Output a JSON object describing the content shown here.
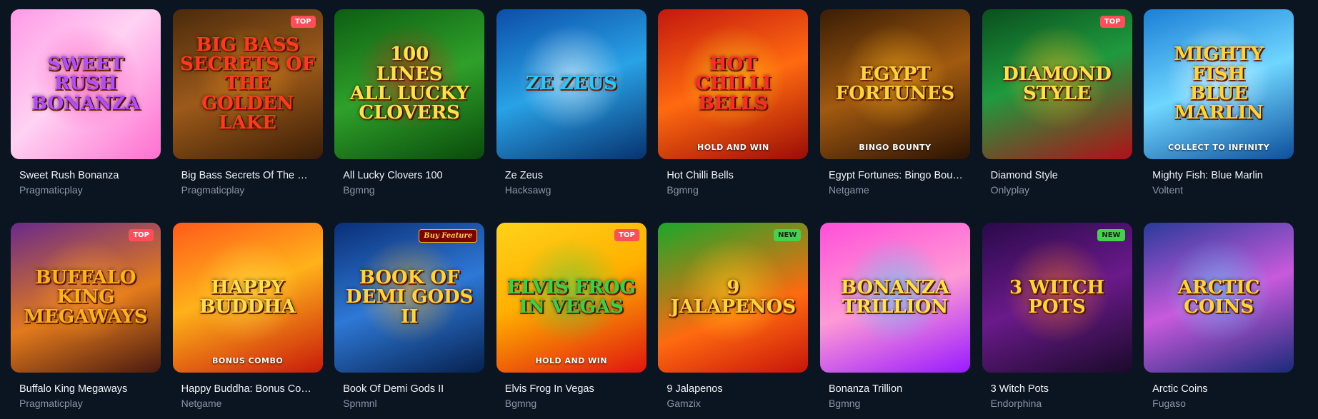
{
  "games": [
    {
      "title": "Sweet Rush Bonanza",
      "provider": "Pragmaticplay",
      "art_title": "Sweet Rush\nBonanza",
      "art_sub": "",
      "badge": "",
      "badge_type": "",
      "bg": "linear-gradient(135deg,#ff9be6,#ffd2f3 45%,#ff6fd0)",
      "glow": "#ff3fb4",
      "title_color": "#b44dff"
    },
    {
      "title": "Big Bass Secrets Of The Golden Lake",
      "provider": "Pragmaticplay",
      "art_title": "Big Bass\nSecrets of\nThe Golden Lake",
      "art_sub": "",
      "badge": "TOP",
      "badge_type": "top",
      "bg": "linear-gradient(160deg,#4a2a0c,#9c5a1a 50%,#3a1d06)",
      "glow": "#e08a1c",
      "title_color": "#ff3a1a"
    },
    {
      "title": "All Lucky Clovers 100",
      "provider": "Bgmng",
      "art_title": "100\nLines\nAll Lucky\nClovers",
      "art_sub": "",
      "badge": "",
      "badge_type": "",
      "bg": "linear-gradient(160deg,#0d5e12,#2fa12a 50%,#0a4a0c)",
      "glow": "#e01818",
      "title_color": "#ffe14a"
    },
    {
      "title": "Ze Zeus",
      "provider": "Hacksawg",
      "art_title": "Ze Zeus",
      "art_sub": "",
      "badge": "",
      "badge_type": "",
      "bg": "linear-gradient(160deg,#0c4ea8,#29a2e6 50%,#07326f)",
      "glow": "#ffffff",
      "title_color": "#2bc7ff"
    },
    {
      "title": "Hot Chilli Bells",
      "provider": "Bgmng",
      "art_title": "Hot\nChilli Bells",
      "art_sub": "HOLD AND WIN",
      "badge": "",
      "badge_type": "",
      "bg": "linear-gradient(160deg,#c3180f,#ff6a10 50%,#9a0c06)",
      "glow": "#ffd21a",
      "title_color": "#ff2a2a"
    },
    {
      "title": "Egypt Fortunes: Bingo Bounty",
      "provider": "Netgame",
      "art_title": "Egypt\nFortunes",
      "art_sub": "BINGO BOUNTY",
      "badge": "",
      "badge_type": "",
      "bg": "linear-gradient(160deg,#3a1d05,#a15a10 50%,#2a1204)",
      "glow": "#ffb21a",
      "title_color": "#ffd43a"
    },
    {
      "title": "Diamond Style",
      "provider": "Onlyplay",
      "art_title": "Diamond\nStyle",
      "art_sub": "",
      "badge": "TOP",
      "badge_type": "top",
      "bg": "linear-gradient(160deg,#0a4f1e,#1f9a3e 45%,#b01018)",
      "glow": "#ffb41a",
      "title_color": "#ffe04a"
    },
    {
      "title": "Mighty Fish: Blue Marlin",
      "provider": "Voltent",
      "art_title": "Mighty Fish\nBlue Marlin",
      "art_sub": "COLLECT TO INFINITY",
      "badge": "",
      "badge_type": "",
      "bg": "linear-gradient(160deg,#1b7fd6,#6fd6ff 50%,#0c4f9c)",
      "glow": "#ffffff",
      "title_color": "#ffd43a"
    },
    {
      "title": "Buffalo King Megaways",
      "provider": "Pragmaticplay",
      "art_title": "Buffalo King\nMegaways",
      "art_sub": "",
      "badge": "TOP",
      "badge_type": "top",
      "bg": "linear-gradient(160deg,#6a2a8a,#e27a1c 55%,#4a1a10)",
      "glow": "#ff9a2a",
      "title_color": "#ffb21a"
    },
    {
      "title": "Happy Buddha: Bonus Combo",
      "provider": "Netgame",
      "art_title": "Happy\nBuddha",
      "art_sub": "BONUS COMBO",
      "badge": "",
      "badge_type": "",
      "bg": "linear-gradient(160deg,#ff5a1a,#ffb21a 45%,#c81a0a)",
      "glow": "#ffe04a",
      "title_color": "#ffe04a"
    },
    {
      "title": "Book Of Demi Gods II",
      "provider": "Spnmnl",
      "art_title": "Book of\nDemi Gods II",
      "art_sub": "",
      "badge": "Buy Feature",
      "badge_type": "buy",
      "bg": "linear-gradient(160deg,#0a2f77,#2e78d6 50%,#06214f)",
      "glow": "#ffb21a",
      "title_color": "#ffd43a"
    },
    {
      "title": "Elvis Frog In Vegas",
      "provider": "Bgmng",
      "art_title": "Elvis Frog\nin Vegas",
      "art_sub": "HOLD AND WIN",
      "badge": "TOP",
      "badge_type": "top",
      "bg": "linear-gradient(160deg,#ffd21a,#ffb000 45%,#e0140f)",
      "glow": "#3ad14a",
      "title_color": "#3ad14a"
    },
    {
      "title": "9 Jalapenos",
      "provider": "Gamzix",
      "art_title": "9 Jalapenos",
      "art_sub": "",
      "badge": "NEW",
      "badge_type": "new",
      "bg": "linear-gradient(160deg,#1aa72a,#ff6a10 60%,#c8140a)",
      "glow": "#ffd21a",
      "title_color": "#ffd43a"
    },
    {
      "title": "Bonanza Trillion",
      "provider": "Bgmng",
      "art_title": "Bonanza\nTrillion",
      "art_sub": "",
      "badge": "",
      "badge_type": "",
      "bg": "linear-gradient(160deg,#ff4fd8,#ff9ad6 50%,#9a1aff)",
      "glow": "#3ad1ff",
      "title_color": "#ffe14a"
    },
    {
      "title": "3 Witch Pots",
      "provider": "Endorphina",
      "art_title": "3 Witch\nPots",
      "art_sub": "",
      "badge": "NEW",
      "badge_type": "new",
      "bg": "linear-gradient(160deg,#2a0a4a,#6a1a8a 50%,#1a0a2a)",
      "glow": "#ff7a1a",
      "title_color": "#ffd43a"
    },
    {
      "title": "Arctic Coins",
      "provider": "Fugaso",
      "art_title": "Arctic\nCoins",
      "art_sub": "",
      "badge": "",
      "badge_type": "",
      "bg": "linear-gradient(160deg,#2a3a9a,#c85adc 50%,#1a2a7a)",
      "glow": "#5ad6ff",
      "title_color": "#ffd43a"
    }
  ]
}
